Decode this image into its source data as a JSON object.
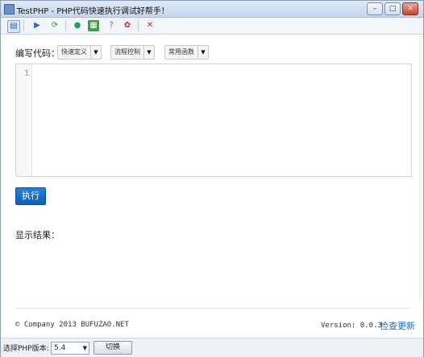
{
  "window": {
    "title": "TestPHP - PHP代码快速执行调试好帮手！",
    "buttons": {
      "minimize": "–",
      "maximize": "□",
      "close": "✕"
    }
  },
  "toolbar": {
    "icons": [
      "file-icon",
      "run-icon",
      "refresh-icon",
      "globe-icon",
      "chart-icon",
      "help-icon",
      "award-icon",
      "close-red-icon"
    ]
  },
  "code_section": {
    "label": "编写代码：",
    "dropdowns": [
      {
        "label": "快速定义"
      },
      {
        "label": "流程控制"
      },
      {
        "label": "常用函数"
      }
    ]
  },
  "editor": {
    "line_numbers": [
      "1"
    ]
  },
  "run_button": {
    "label": "执行"
  },
  "result": {
    "label": "显示结果："
  },
  "footer": {
    "copyright": "© Company 2013 BUFUZAO.NET",
    "version": "Version: 0.0.3",
    "update_link": "检查更新"
  },
  "statusbar": {
    "php_version_label": "选择PHP版本:",
    "php_version_value": "5.4",
    "switch_button": "切换"
  }
}
